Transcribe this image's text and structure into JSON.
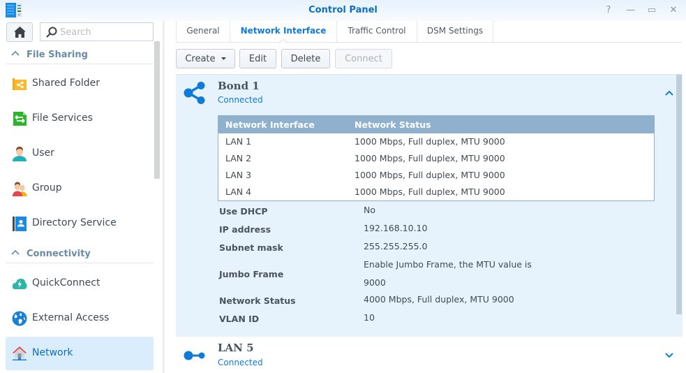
{
  "window": {
    "title": "Control Panel",
    "controls": {
      "help": "?",
      "minimize": "—",
      "maximize": "▭",
      "close": "✕"
    }
  },
  "sidebar": {
    "search_placeholder": "Search",
    "groups": [
      {
        "label": "File Sharing",
        "items": [
          {
            "label": "Shared Folder",
            "icon": "shared-folder-icon"
          },
          {
            "label": "File Services",
            "icon": "file-services-icon"
          },
          {
            "label": "User",
            "icon": "user-icon"
          },
          {
            "label": "Group",
            "icon": "group-icon"
          },
          {
            "label": "Directory Service",
            "icon": "directory-service-icon"
          }
        ]
      },
      {
        "label": "Connectivity",
        "items": [
          {
            "label": "QuickConnect",
            "icon": "quickconnect-icon"
          },
          {
            "label": "External Access",
            "icon": "globe-icon"
          },
          {
            "label": "Network",
            "icon": "network-house-icon",
            "active": true
          }
        ]
      }
    ]
  },
  "tabs": [
    {
      "label": "General"
    },
    {
      "label": "Network Interface",
      "active": true
    },
    {
      "label": "Traffic Control"
    },
    {
      "label": "DSM Settings"
    }
  ],
  "toolbar": {
    "create": "Create",
    "edit": "Edit",
    "delete": "Delete",
    "connect": "Connect"
  },
  "interfaces": [
    {
      "name": "Bond 1",
      "status": "Connected",
      "expanded": true,
      "table": {
        "headers": [
          "Network Interface",
          "Network Status"
        ],
        "rows": [
          [
            "LAN 1",
            "1000 Mbps, Full duplex, MTU 9000"
          ],
          [
            "LAN 2",
            "1000 Mbps, Full duplex, MTU 9000"
          ],
          [
            "LAN 3",
            "1000 Mbps, Full duplex, MTU 9000"
          ],
          [
            "LAN 4",
            "1000 Mbps, Full duplex, MTU 9000"
          ]
        ]
      },
      "properties": [
        {
          "label": "Use DHCP",
          "value": "No"
        },
        {
          "label": "IP address",
          "value": "192.168.10.10"
        },
        {
          "label": "Subnet mask",
          "value": "255.255.255.0"
        },
        {
          "label": "Jumbo Frame",
          "value": "Enable Jumbo Frame, the MTU value is 9000"
        },
        {
          "label": "Network Status",
          "value": "4000 Mbps, Full duplex, MTU 9000"
        },
        {
          "label": "VLAN ID",
          "value": "10"
        }
      ]
    },
    {
      "name": "LAN 5",
      "status": "Connected",
      "expanded": false
    }
  ],
  "colors": {
    "accent": "#0f7ad8",
    "title": "#0f6fbf",
    "table_header": "#8fb1cd",
    "card_bg": "#e6f3fd",
    "active_nav_bg": "#daedfd"
  }
}
